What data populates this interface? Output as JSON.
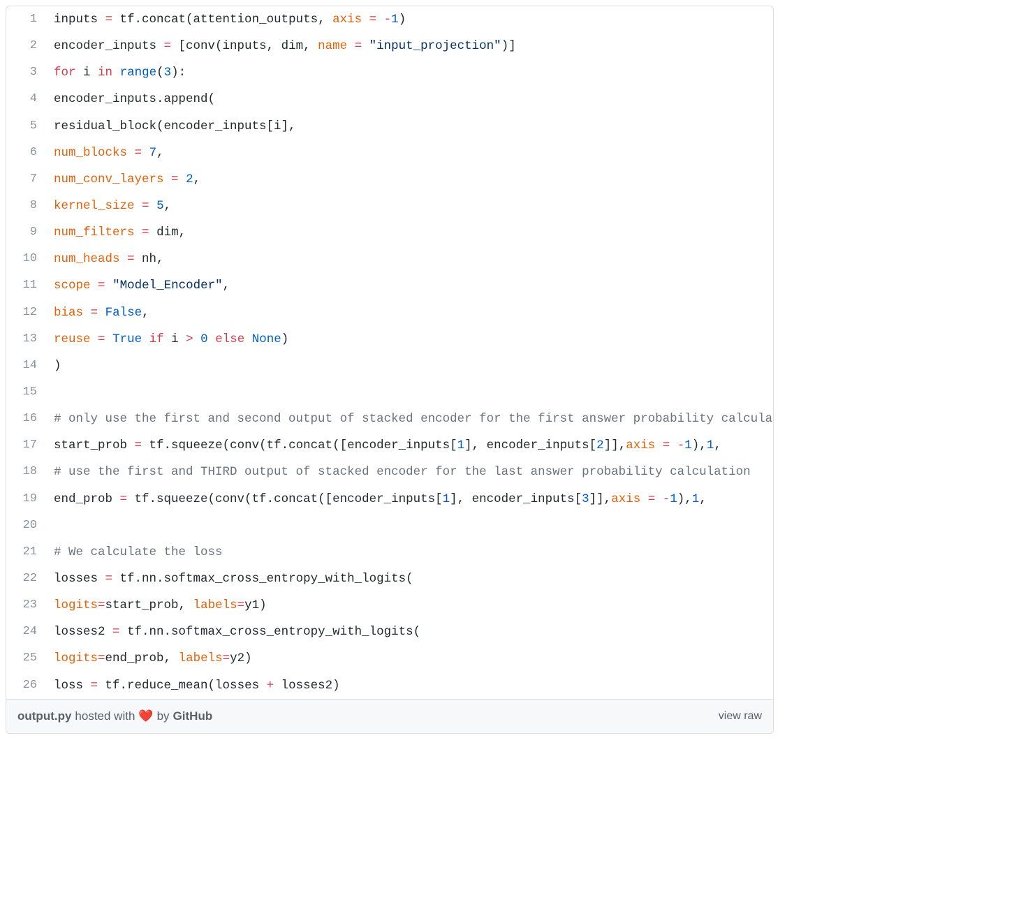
{
  "filename": "output.py",
  "hosted_text_prefix": " hosted with ",
  "hosted_text_suffix": " by ",
  "github_label": "GitHub",
  "heart": "❤️",
  "view_raw_label": "view raw",
  "lines": [
    {
      "n": 1,
      "segs": [
        [
          "",
          "  inputs "
        ],
        [
          "kw",
          "="
        ],
        [
          "",
          " tf.concat(attention_outputs, "
        ],
        [
          "par",
          "axis"
        ],
        [
          "",
          " "
        ],
        [
          "kw",
          "="
        ],
        [
          "",
          " "
        ],
        [
          "kw",
          "-"
        ],
        [
          "bi",
          "1"
        ],
        [
          "",
          ")"
        ]
      ]
    },
    {
      "n": 2,
      "segs": [
        [
          "",
          "  encoder_inputs "
        ],
        [
          "kw",
          "="
        ],
        [
          "",
          " [conv(inputs, dim, "
        ],
        [
          "par",
          "name"
        ],
        [
          "",
          " "
        ],
        [
          "kw",
          "="
        ],
        [
          "",
          " "
        ],
        [
          "str",
          "\"input_projection\""
        ],
        [
          "",
          ")]"
        ]
      ]
    },
    {
      "n": 3,
      "segs": [
        [
          "",
          "  "
        ],
        [
          "kw",
          "for"
        ],
        [
          "",
          " i "
        ],
        [
          "kw",
          "in"
        ],
        [
          "",
          " "
        ],
        [
          "bi",
          "range"
        ],
        [
          "",
          "("
        ],
        [
          "bi",
          "3"
        ],
        [
          "",
          "):"
        ]
      ]
    },
    {
      "n": 4,
      "segs": [
        [
          "",
          "      encoder_inputs.append("
        ]
      ]
    },
    {
      "n": 5,
      "segs": [
        [
          "",
          "          residual_block(encoder_inputs[i],"
        ]
      ]
    },
    {
      "n": 6,
      "segs": [
        [
          "",
          "              "
        ],
        [
          "par",
          "num_blocks"
        ],
        [
          "",
          " "
        ],
        [
          "kw",
          "="
        ],
        [
          "",
          " "
        ],
        [
          "bi",
          "7"
        ],
        [
          "",
          ","
        ]
      ]
    },
    {
      "n": 7,
      "segs": [
        [
          "",
          "              "
        ],
        [
          "par",
          "num_conv_layers"
        ],
        [
          "",
          " "
        ],
        [
          "kw",
          "="
        ],
        [
          "",
          " "
        ],
        [
          "bi",
          "2"
        ],
        [
          "",
          ","
        ]
      ]
    },
    {
      "n": 8,
      "segs": [
        [
          "",
          "              "
        ],
        [
          "par",
          "kernel_size"
        ],
        [
          "",
          " "
        ],
        [
          "kw",
          "="
        ],
        [
          "",
          " "
        ],
        [
          "bi",
          "5"
        ],
        [
          "",
          ","
        ]
      ]
    },
    {
      "n": 9,
      "segs": [
        [
          "",
          "              "
        ],
        [
          "par",
          "num_filters"
        ],
        [
          "",
          " "
        ],
        [
          "kw",
          "="
        ],
        [
          "",
          " dim,"
        ]
      ]
    },
    {
      "n": 10,
      "segs": [
        [
          "",
          "              "
        ],
        [
          "par",
          "num_heads"
        ],
        [
          "",
          " "
        ],
        [
          "kw",
          "="
        ],
        [
          "",
          " nh,"
        ]
      ]
    },
    {
      "n": 11,
      "segs": [
        [
          "",
          "              "
        ],
        [
          "par",
          "scope"
        ],
        [
          "",
          " "
        ],
        [
          "kw",
          "="
        ],
        [
          "",
          " "
        ],
        [
          "str",
          "\"Model_Encoder\""
        ],
        [
          "",
          ","
        ]
      ]
    },
    {
      "n": 12,
      "segs": [
        [
          "",
          "              "
        ],
        [
          "par",
          "bias"
        ],
        [
          "",
          " "
        ],
        [
          "kw",
          "="
        ],
        [
          "",
          " "
        ],
        [
          "bi",
          "False"
        ],
        [
          "",
          ","
        ]
      ]
    },
    {
      "n": 13,
      "segs": [
        [
          "",
          "              "
        ],
        [
          "par",
          "reuse"
        ],
        [
          "",
          " "
        ],
        [
          "kw",
          "="
        ],
        [
          "",
          " "
        ],
        [
          "bi",
          "True"
        ],
        [
          "",
          " "
        ],
        [
          "kw",
          "if"
        ],
        [
          "",
          " i "
        ],
        [
          "kw",
          ">"
        ],
        [
          "",
          " "
        ],
        [
          "bi",
          "0"
        ],
        [
          "",
          " "
        ],
        [
          "kw",
          "else"
        ],
        [
          "",
          " "
        ],
        [
          "bi",
          "None"
        ],
        [
          "",
          ")"
        ]
      ]
    },
    {
      "n": 14,
      "segs": [
        [
          "",
          "          )"
        ]
      ]
    },
    {
      "n": 15,
      "segs": [
        [
          "",
          ""
        ]
      ]
    },
    {
      "n": 16,
      "segs": [
        [
          "",
          "  "
        ],
        [
          "cmt",
          "# only use the first and second output of stacked encoder for the first answer probability calculation"
        ]
      ]
    },
    {
      "n": 17,
      "segs": [
        [
          "",
          "  start_prob "
        ],
        [
          "kw",
          "="
        ],
        [
          "",
          " tf.squeeze(conv(tf.concat([encoder_inputs["
        ],
        [
          "bi",
          "1"
        ],
        [
          "",
          "], encoder_inputs["
        ],
        [
          "bi",
          "2"
        ],
        [
          "",
          "]],"
        ],
        [
          "par",
          "axis"
        ],
        [
          "",
          " "
        ],
        [
          "kw",
          "="
        ],
        [
          "",
          " "
        ],
        [
          "kw",
          "-"
        ],
        [
          "bi",
          "1"
        ],
        [
          "",
          "),"
        ],
        [
          "bi",
          "1"
        ],
        [
          "",
          ","
        ]
      ]
    },
    {
      "n": 18,
      "segs": [
        [
          "",
          "  "
        ],
        [
          "cmt",
          "# use the first and THIRD output of stacked encoder for the last answer probability calculation"
        ]
      ]
    },
    {
      "n": 19,
      "segs": [
        [
          "",
          "  end_prob "
        ],
        [
          "kw",
          "="
        ],
        [
          "",
          " tf.squeeze(conv(tf.concat([encoder_inputs["
        ],
        [
          "bi",
          "1"
        ],
        [
          "",
          "], encoder_inputs["
        ],
        [
          "bi",
          "3"
        ],
        [
          "",
          "]],"
        ],
        [
          "par",
          "axis"
        ],
        [
          "",
          " "
        ],
        [
          "kw",
          "="
        ],
        [
          "",
          " "
        ],
        [
          "kw",
          "-"
        ],
        [
          "bi",
          "1"
        ],
        [
          "",
          "),"
        ],
        [
          "bi",
          "1"
        ],
        [
          "",
          ","
        ]
      ]
    },
    {
      "n": 20,
      "segs": [
        [
          "",
          ""
        ]
      ]
    },
    {
      "n": 21,
      "segs": [
        [
          "",
          "  "
        ],
        [
          "cmt",
          "# We calculate the loss"
        ]
      ]
    },
    {
      "n": 22,
      "segs": [
        [
          "",
          "  losses "
        ],
        [
          "kw",
          "="
        ],
        [
          "",
          " tf.nn.softmax_cross_entropy_with_logits("
        ]
      ]
    },
    {
      "n": 23,
      "segs": [
        [
          "",
          "      "
        ],
        [
          "par",
          "logits"
        ],
        [
          "kw",
          "="
        ],
        [
          "",
          "start_prob, "
        ],
        [
          "par",
          "labels"
        ],
        [
          "kw",
          "="
        ],
        [
          "",
          "y1)"
        ]
      ]
    },
    {
      "n": 24,
      "segs": [
        [
          "",
          "  losses2 "
        ],
        [
          "kw",
          "="
        ],
        [
          "",
          " tf.nn.softmax_cross_entropy_with_logits("
        ]
      ]
    },
    {
      "n": 25,
      "segs": [
        [
          "",
          "      "
        ],
        [
          "par",
          "logits"
        ],
        [
          "kw",
          "="
        ],
        [
          "",
          "end_prob, "
        ],
        [
          "par",
          "labels"
        ],
        [
          "kw",
          "="
        ],
        [
          "",
          "y2)"
        ]
      ]
    },
    {
      "n": 26,
      "segs": [
        [
          "",
          "  loss "
        ],
        [
          "kw",
          "="
        ],
        [
          "",
          " tf.reduce_mean(losses "
        ],
        [
          "kw",
          "+"
        ],
        [
          "",
          " losses2)"
        ]
      ]
    }
  ]
}
